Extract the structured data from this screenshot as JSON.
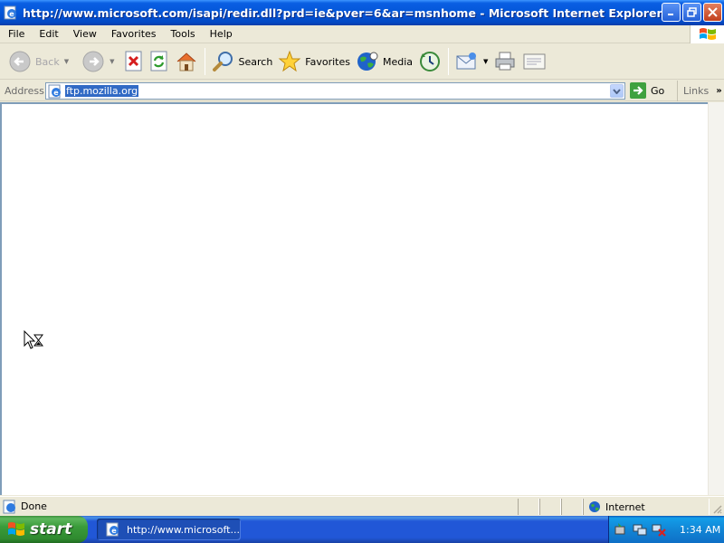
{
  "window": {
    "title": "http://www.microsoft.com/isapi/redir.dll?prd=ie&pver=6&ar=msnhome - Microsoft Internet Explorer"
  },
  "menu": {
    "items": [
      "File",
      "Edit",
      "View",
      "Favorites",
      "Tools",
      "Help"
    ]
  },
  "toolbar": {
    "back_label": "Back",
    "search_label": "Search",
    "favorites_label": "Favorites",
    "media_label": "Media"
  },
  "address": {
    "label": "Address",
    "value": "ftp.mozilla.org",
    "go_label": "Go",
    "links_label": "Links",
    "links_chevron": "»"
  },
  "status": {
    "text": "Done",
    "zone_label": "Internet"
  },
  "taskbar": {
    "start_label": "start",
    "task_label": "http://www.microsoft...",
    "clock": "1:34 AM"
  },
  "colors": {
    "titlebar": "#0456d8",
    "selection": "#316ac5",
    "start_green": "#3a9b3a",
    "taskbar_blue": "#2157d7",
    "tray_blue": "#1186d6"
  },
  "icons": {
    "title": "ie-page-icon",
    "back": "back-arrow-icon",
    "forward": "forward-arrow-icon",
    "stop": "stop-icon",
    "refresh": "refresh-icon",
    "home": "home-icon",
    "search": "magnifier-icon",
    "favorites": "star-icon",
    "media": "globe-media-icon",
    "history": "history-icon",
    "mail": "mail-icon",
    "print": "printer-icon",
    "edit": "edit-icon",
    "cursor": "busy-cursor-icon"
  }
}
